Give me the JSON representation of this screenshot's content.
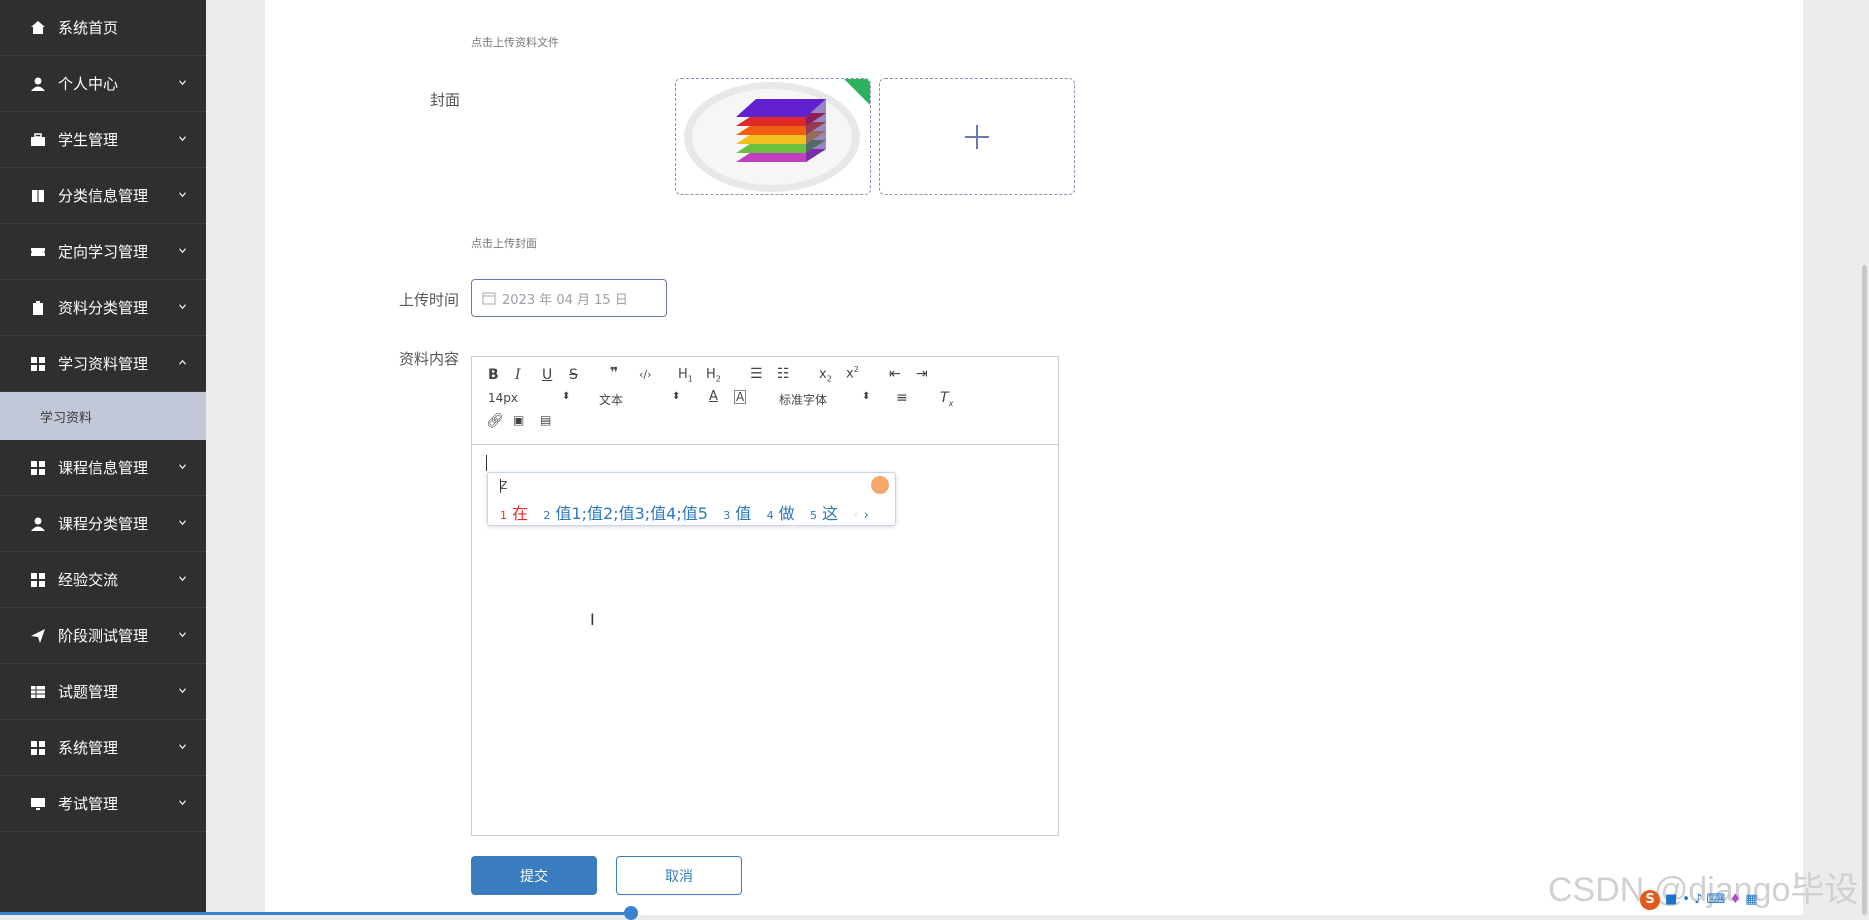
{
  "sidebar": {
    "items": [
      {
        "label": "系统首页",
        "icon": "home-icon",
        "chevron": "none"
      },
      {
        "label": "个人中心",
        "icon": "user-icon",
        "chevron": "down"
      },
      {
        "label": "学生管理",
        "icon": "briefcase-icon",
        "chevron": "down"
      },
      {
        "label": "分类信息管理",
        "icon": "book-icon",
        "chevron": "down"
      },
      {
        "label": "定向学习管理",
        "icon": "ticket-icon",
        "chevron": "down"
      },
      {
        "label": "资料分类管理",
        "icon": "clipboard-icon",
        "chevron": "down"
      },
      {
        "label": "学习资料管理",
        "icon": "grid-icon",
        "chevron": "up"
      }
    ],
    "active_sub": "学习资料",
    "items_after": [
      {
        "label": "课程信息管理",
        "icon": "grid-icon",
        "chevron": "down"
      },
      {
        "label": "课程分类管理",
        "icon": "user-icon",
        "chevron": "down"
      },
      {
        "label": "经验交流",
        "icon": "grid-icon",
        "chevron": "down"
      },
      {
        "label": "阶段测试管理",
        "icon": "send-icon",
        "chevron": "down"
      },
      {
        "label": "试题管理",
        "icon": "table-icon",
        "chevron": "down"
      },
      {
        "label": "系统管理",
        "icon": "grid-icon",
        "chevron": "down"
      },
      {
        "label": "考试管理",
        "icon": "monitor-icon",
        "chevron": "down"
      }
    ]
  },
  "form": {
    "file_hint": "点击上传资料文件",
    "cover_label": "封面",
    "cover_hint": "点击上传封面",
    "upload_time_label": "上传时间",
    "upload_time_value": "2023 年 04 月 15 日",
    "content_label": "资料内容"
  },
  "editor": {
    "toolbar_row1": [
      "B",
      "I",
      "U",
      "S",
      "99",
      "</>",
      "H1",
      "H2",
      "ol",
      "ul",
      "x2",
      "x²",
      "outdent",
      "indent"
    ],
    "font_size": "14px",
    "text_type": "文本",
    "font_family": "标准字体"
  },
  "ime": {
    "input": "z",
    "candidates": [
      {
        "num": "1",
        "text": "在"
      },
      {
        "num": "2",
        "text": "值1;值2;值3;值4;值5"
      },
      {
        "num": "3",
        "text": "值"
      },
      {
        "num": "4",
        "text": "做"
      },
      {
        "num": "5",
        "text": "这"
      }
    ]
  },
  "buttons": {
    "submit": "提交",
    "cancel": "取消"
  },
  "watermark": "CSDN @django毕设",
  "colors": {
    "sidebar": "#2f2f2f",
    "primary": "#3a7cc0",
    "accent": "#6b78b4"
  }
}
